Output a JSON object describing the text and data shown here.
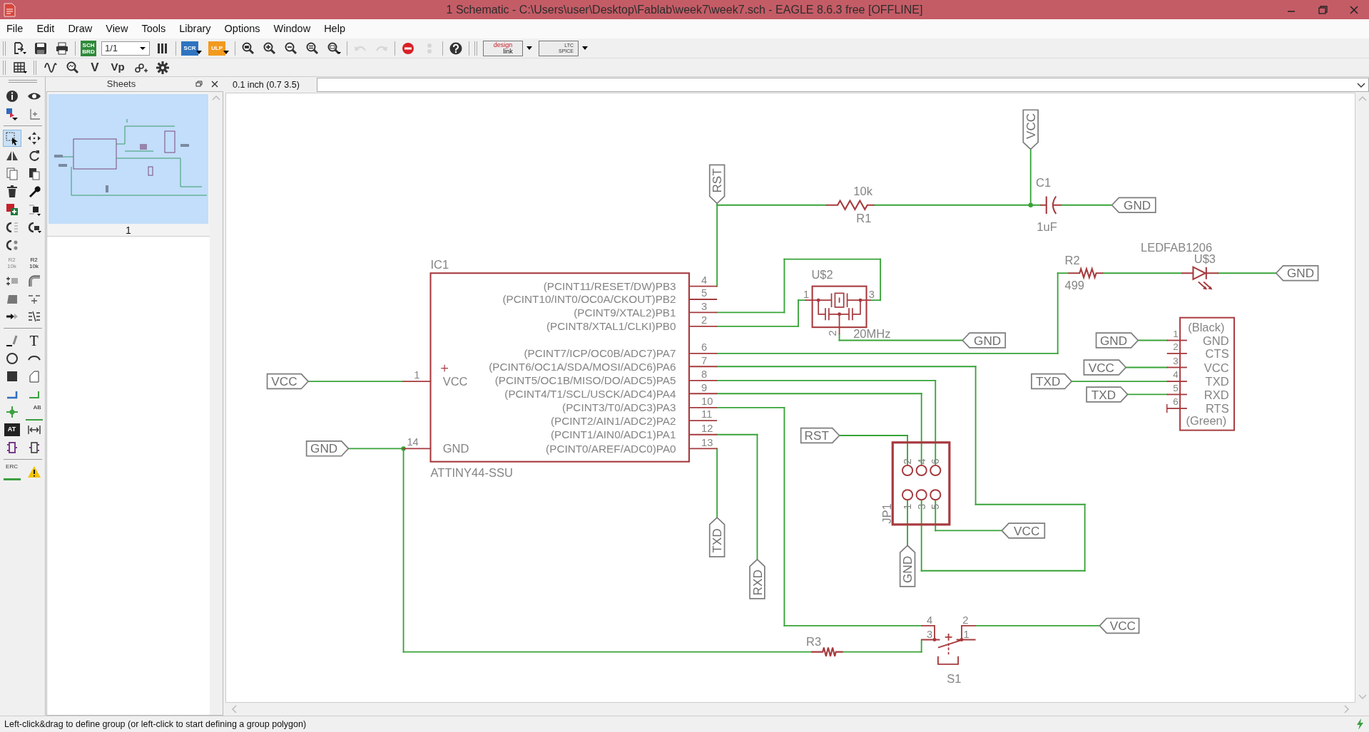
{
  "window": {
    "title": "1 Schematic - C:\\Users\\user\\Desktop\\Fablab\\week7\\week7.sch - EAGLE 8.6.3 free [OFFLINE]"
  },
  "menu": [
    "File",
    "Edit",
    "Draw",
    "View",
    "Tools",
    "Library",
    "Options",
    "Window",
    "Help"
  ],
  "toolbar": [
    {
      "disabled": false
    },
    {
      "disabled": false
    },
    {
      "disabled": false
    },
    {
      "glyph": [
        "SCH",
        "BRD"
      ],
      "disabled": false
    },
    {
      "value": "1/1",
      "disabled": false
    },
    {
      "disabled": false
    },
    {
      "glyph": [
        "SCR"
      ],
      "disabled": false
    },
    {
      "glyph": [
        "ULP"
      ],
      "disabled": false
    },
    {
      "disabled": false
    },
    {
      "disabled": false
    },
    {
      "disabled": false
    },
    {
      "disabled": false
    },
    {
      "disabled": false
    },
    {
      "disabled": true
    },
    {
      "disabled": true
    },
    {
      "disabled": false
    },
    {
      "disabled": true
    },
    {
      "disabled": false
    },
    {
      "glyph": [
        "design",
        "link"
      ],
      "disabled": false
    },
    {
      "glyph": [
        "LTC",
        "SPICE"
      ],
      "disabled": false
    }
  ],
  "toolbar2": [
    "V",
    "Vp"
  ],
  "tool_palette": [
    [
      {
        "selected": false
      },
      {
        "selected": false
      }
    ],
    [
      {
        "selected": false
      },
      {
        "selected": false
      }
    ],
    [
      {
        "selected": true
      },
      {
        "selected": false
      }
    ],
    [
      {
        "selected": false
      },
      {
        "selected": false
      }
    ],
    [
      {
        "selected": false
      },
      {
        "selected": false
      }
    ],
    [
      {
        "selected": false
      },
      {
        "selected": false
      }
    ],
    [
      {
        "selected": false
      },
      {
        "selected": false
      }
    ],
    [
      {
        "selected": false
      },
      {
        "selected": false
      }
    ],
    [
      {
        "selected": false
      }
    ],
    [
      {
        "glyph": [
          "R2",
          "10k"
        ],
        "selected": false
      },
      {
        "glyph": [
          "R2",
          "10k"
        ],
        "selected": false
      }
    ],
    [
      {
        "selected": false
      },
      {
        "selected": false
      }
    ],
    [
      {
        "selected": false
      },
      {
        "selected": false
      }
    ],
    [
      {
        "selected": false
      },
      {
        "selected": false
      }
    ],
    [
      {
        "selected": false
      },
      {
        "glyph": [
          "T"
        ],
        "selected": false
      }
    ],
    [
      {
        "selected": false
      },
      {
        "selected": false
      }
    ],
    [
      {
        "selected": false
      },
      {
        "selected": false
      }
    ],
    [
      {
        "selected": false
      },
      {
        "selected": false
      }
    ],
    [
      {
        "selected": false
      },
      {
        "glyph": [
          "AB"
        ],
        "selected": false
      }
    ],
    [
      {
        "glyph": [
          "AT"
        ],
        "selected": false
      },
      {
        "selected": false
      }
    ],
    [
      {
        "selected": false
      },
      {
        "selected": false
      }
    ],
    [
      {
        "glyph": [
          "ERC"
        ],
        "selected": false
      },
      {
        "selected": false
      }
    ]
  ],
  "sheets_panel": {
    "title": "Sheets",
    "sheets": [
      {
        "label": "1",
        "selected": true
      }
    ]
  },
  "command_bar": {
    "grid_readout": "0.1 inch (0.7 3.5)"
  },
  "schematic": {
    "ic1": {
      "name": "IC1",
      "value": "ATTINY44-SSU",
      "left_pins": [
        {
          "number": "1",
          "name": "VCC"
        },
        {
          "number": "14",
          "name": "GND"
        }
      ],
      "right_pins": [
        {
          "number": "4",
          "name": "(PCINT11/RESET/DW)PB3"
        },
        {
          "number": "5",
          "name": "(PCINT10/INT0/OC0A/CKOUT)PB2"
        },
        {
          "number": "3",
          "name": "(PCINT9/XTAL2)PB1"
        },
        {
          "number": "2",
          "name": "(PCINT8/XTAL1/CLKI)PB0"
        },
        {
          "number": "6",
          "name": "(PCINT7/ICP/OC0B/ADC7)PA7"
        },
        {
          "number": "7",
          "name": "(PCINT6/OC1A/SDA/MOSI/ADC6)PA6"
        },
        {
          "number": "8",
          "name": "(PCINT5/OC1B/MISO/DO/ADC5)PA5"
        },
        {
          "number": "9",
          "name": "(PCINT4/T1/SCL/USCK/ADC4)PA4"
        },
        {
          "number": "10",
          "name": "(PCINT3/T0/ADC3)PA3"
        },
        {
          "number": "11",
          "name": "(PCINT2/AIN1/ADC2)PA2"
        },
        {
          "number": "12",
          "name": "(PCINT1/AIN0/ADC1)PA1"
        },
        {
          "number": "13",
          "name": "(PCINT0/AREF/ADC0)PA0"
        }
      ]
    },
    "r1": {
      "name": "R1",
      "value": "10k"
    },
    "c1": {
      "name": "C1",
      "value": "1uF"
    },
    "r2": {
      "name": "R2",
      "value": "499"
    },
    "led": {
      "name": "U$3",
      "value": "LEDFAB1206"
    },
    "resonator": {
      "name": "U$2",
      "value": "20MHz",
      "pins": [
        "1",
        "2",
        "3"
      ]
    },
    "ftdi": {
      "top_text": "(Black)",
      "bottom_text": "(Green)",
      "pins": [
        {
          "number": "1",
          "name": "GND"
        },
        {
          "number": "2",
          "name": "CTS"
        },
        {
          "number": "3",
          "name": "VCC"
        },
        {
          "number": "4",
          "name": "TXD"
        },
        {
          "number": "5",
          "name": "RXD"
        },
        {
          "number": "6",
          "name": "RTS"
        }
      ]
    },
    "jp1": {
      "name": "JP1",
      "pins": [
        "2",
        "4",
        "6",
        "1",
        "3",
        "5"
      ]
    },
    "s1": {
      "name": "S1",
      "pins": [
        "4",
        "3",
        "2",
        "1"
      ]
    },
    "r3": {
      "name": "R3"
    },
    "net_labels": [
      "VCC",
      "RST",
      "GND",
      "GND",
      "GND",
      "GND",
      "VCC",
      "TXD",
      "TXD",
      "VCC",
      "GND",
      "RST",
      "TXD",
      "RXD",
      "VCC",
      "GND",
      "VCC"
    ]
  },
  "status_bar": {
    "message": "Left-click&drag to define group (or left-click to start defining a group polygon)"
  }
}
